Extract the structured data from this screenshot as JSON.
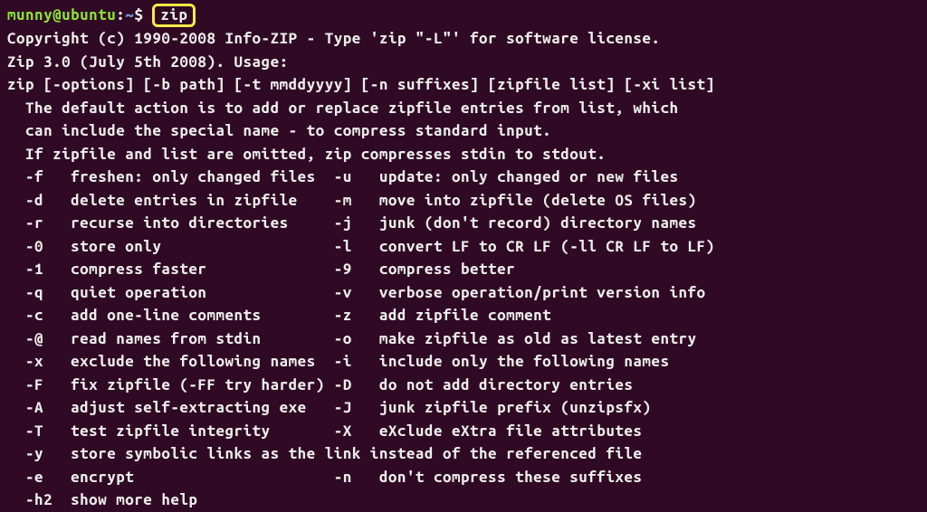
{
  "prompt": {
    "user_host": "munny@ubuntu",
    "colon": ":",
    "path": "~",
    "dollar": "$",
    "command": "zip"
  },
  "output": {
    "copyright": "Copyright (c) 1990-2008 Info-ZIP - Type 'zip \"-L\"' for software license.",
    "version_usage": "Zip 3.0 (July 5th 2008). Usage:",
    "syntax": "zip [-options] [-b path] [-t mmddyyyy] [-n suffixes] [zipfile list] [-xi list]",
    "desc1": "  The default action is to add or replace zipfile entries from list, which",
    "desc2": "  can include the special name - to compress standard input.",
    "desc3": "  If zipfile and list are omitted, zip compresses stdin to stdout.",
    "opt_f": "  -f   freshen: only changed files  -u   update: only changed or new files",
    "opt_d": "  -d   delete entries in zipfile    -m   move into zipfile (delete OS files)",
    "opt_r": "  -r   recurse into directories     -j   junk (don't record) directory names",
    "opt_0": "  -0   store only                   -l   convert LF to CR LF (-ll CR LF to LF)",
    "opt_1": "  -1   compress faster              -9   compress better",
    "opt_q": "  -q   quiet operation              -v   verbose operation/print version info",
    "opt_c": "  -c   add one-line comments        -z   add zipfile comment",
    "opt_at": "  -@   read names from stdin        -o   make zipfile as old as latest entry",
    "opt_x": "  -x   exclude the following names  -i   include only the following names",
    "opt_F": "  -F   fix zipfile (-FF try harder) -D   do not add directory entries",
    "opt_A": "  -A   adjust self-extracting exe   -J   junk zipfile prefix (unzipsfx)",
    "opt_T": "  -T   test zipfile integrity       -X   eXclude eXtra file attributes",
    "opt_y": "  -y   store symbolic links as the link instead of the referenced file",
    "opt_e": "  -e   encrypt                      -n   don't compress these suffixes",
    "opt_h2": "  -h2  show more help"
  },
  "colors": {
    "background": "#300a24",
    "foreground": "#eeeeec",
    "prompt_green": "#8ae234",
    "prompt_blue": "#729fcf",
    "highlight_yellow": "#f9e949"
  }
}
